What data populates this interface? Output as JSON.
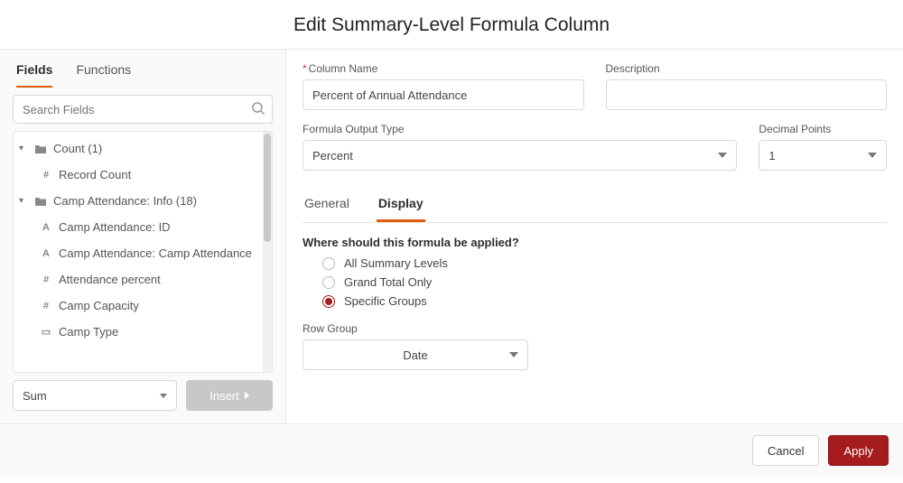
{
  "header": {
    "title": "Edit Summary-Level Formula Column"
  },
  "left": {
    "tabs": [
      {
        "label": "Fields",
        "active": true
      },
      {
        "label": "Functions",
        "active": false
      }
    ],
    "search_placeholder": "Search Fields",
    "tree": {
      "groups": [
        {
          "label": "Count (1)",
          "items": [
            {
              "icon": "#",
              "label": "Record Count"
            }
          ]
        },
        {
          "label": "Camp Attendance: Info (18)",
          "items": [
            {
              "icon": "A",
              "label": "Camp Attendance: ID"
            },
            {
              "icon": "A",
              "label": "Camp Attendance: Camp Attendance"
            },
            {
              "icon": "#",
              "label": "Attendance percent"
            },
            {
              "icon": "#",
              "label": "Camp Capacity"
            },
            {
              "icon": "▭",
              "label": "Camp Type"
            }
          ]
        }
      ]
    },
    "agg_select": "Sum",
    "insert_label": "Insert"
  },
  "right": {
    "column_name": {
      "label": "Column Name",
      "value": "Percent of Annual Attendance"
    },
    "description": {
      "label": "Description",
      "value": ""
    },
    "output_type": {
      "label": "Formula Output Type",
      "value": "Percent"
    },
    "decimal_points": {
      "label": "Decimal Points",
      "value": "1"
    },
    "subtabs": [
      {
        "label": "General",
        "active": false
      },
      {
        "label": "Display",
        "active": true
      }
    ],
    "question": "Where should this formula be applied?",
    "radios": [
      {
        "label": "All Summary Levels",
        "checked": false
      },
      {
        "label": "Grand Total Only",
        "checked": false
      },
      {
        "label": "Specific Groups",
        "checked": true
      }
    ],
    "row_group": {
      "label": "Row Group",
      "value": "Date"
    }
  },
  "footer": {
    "cancel": "Cancel",
    "apply": "Apply"
  }
}
